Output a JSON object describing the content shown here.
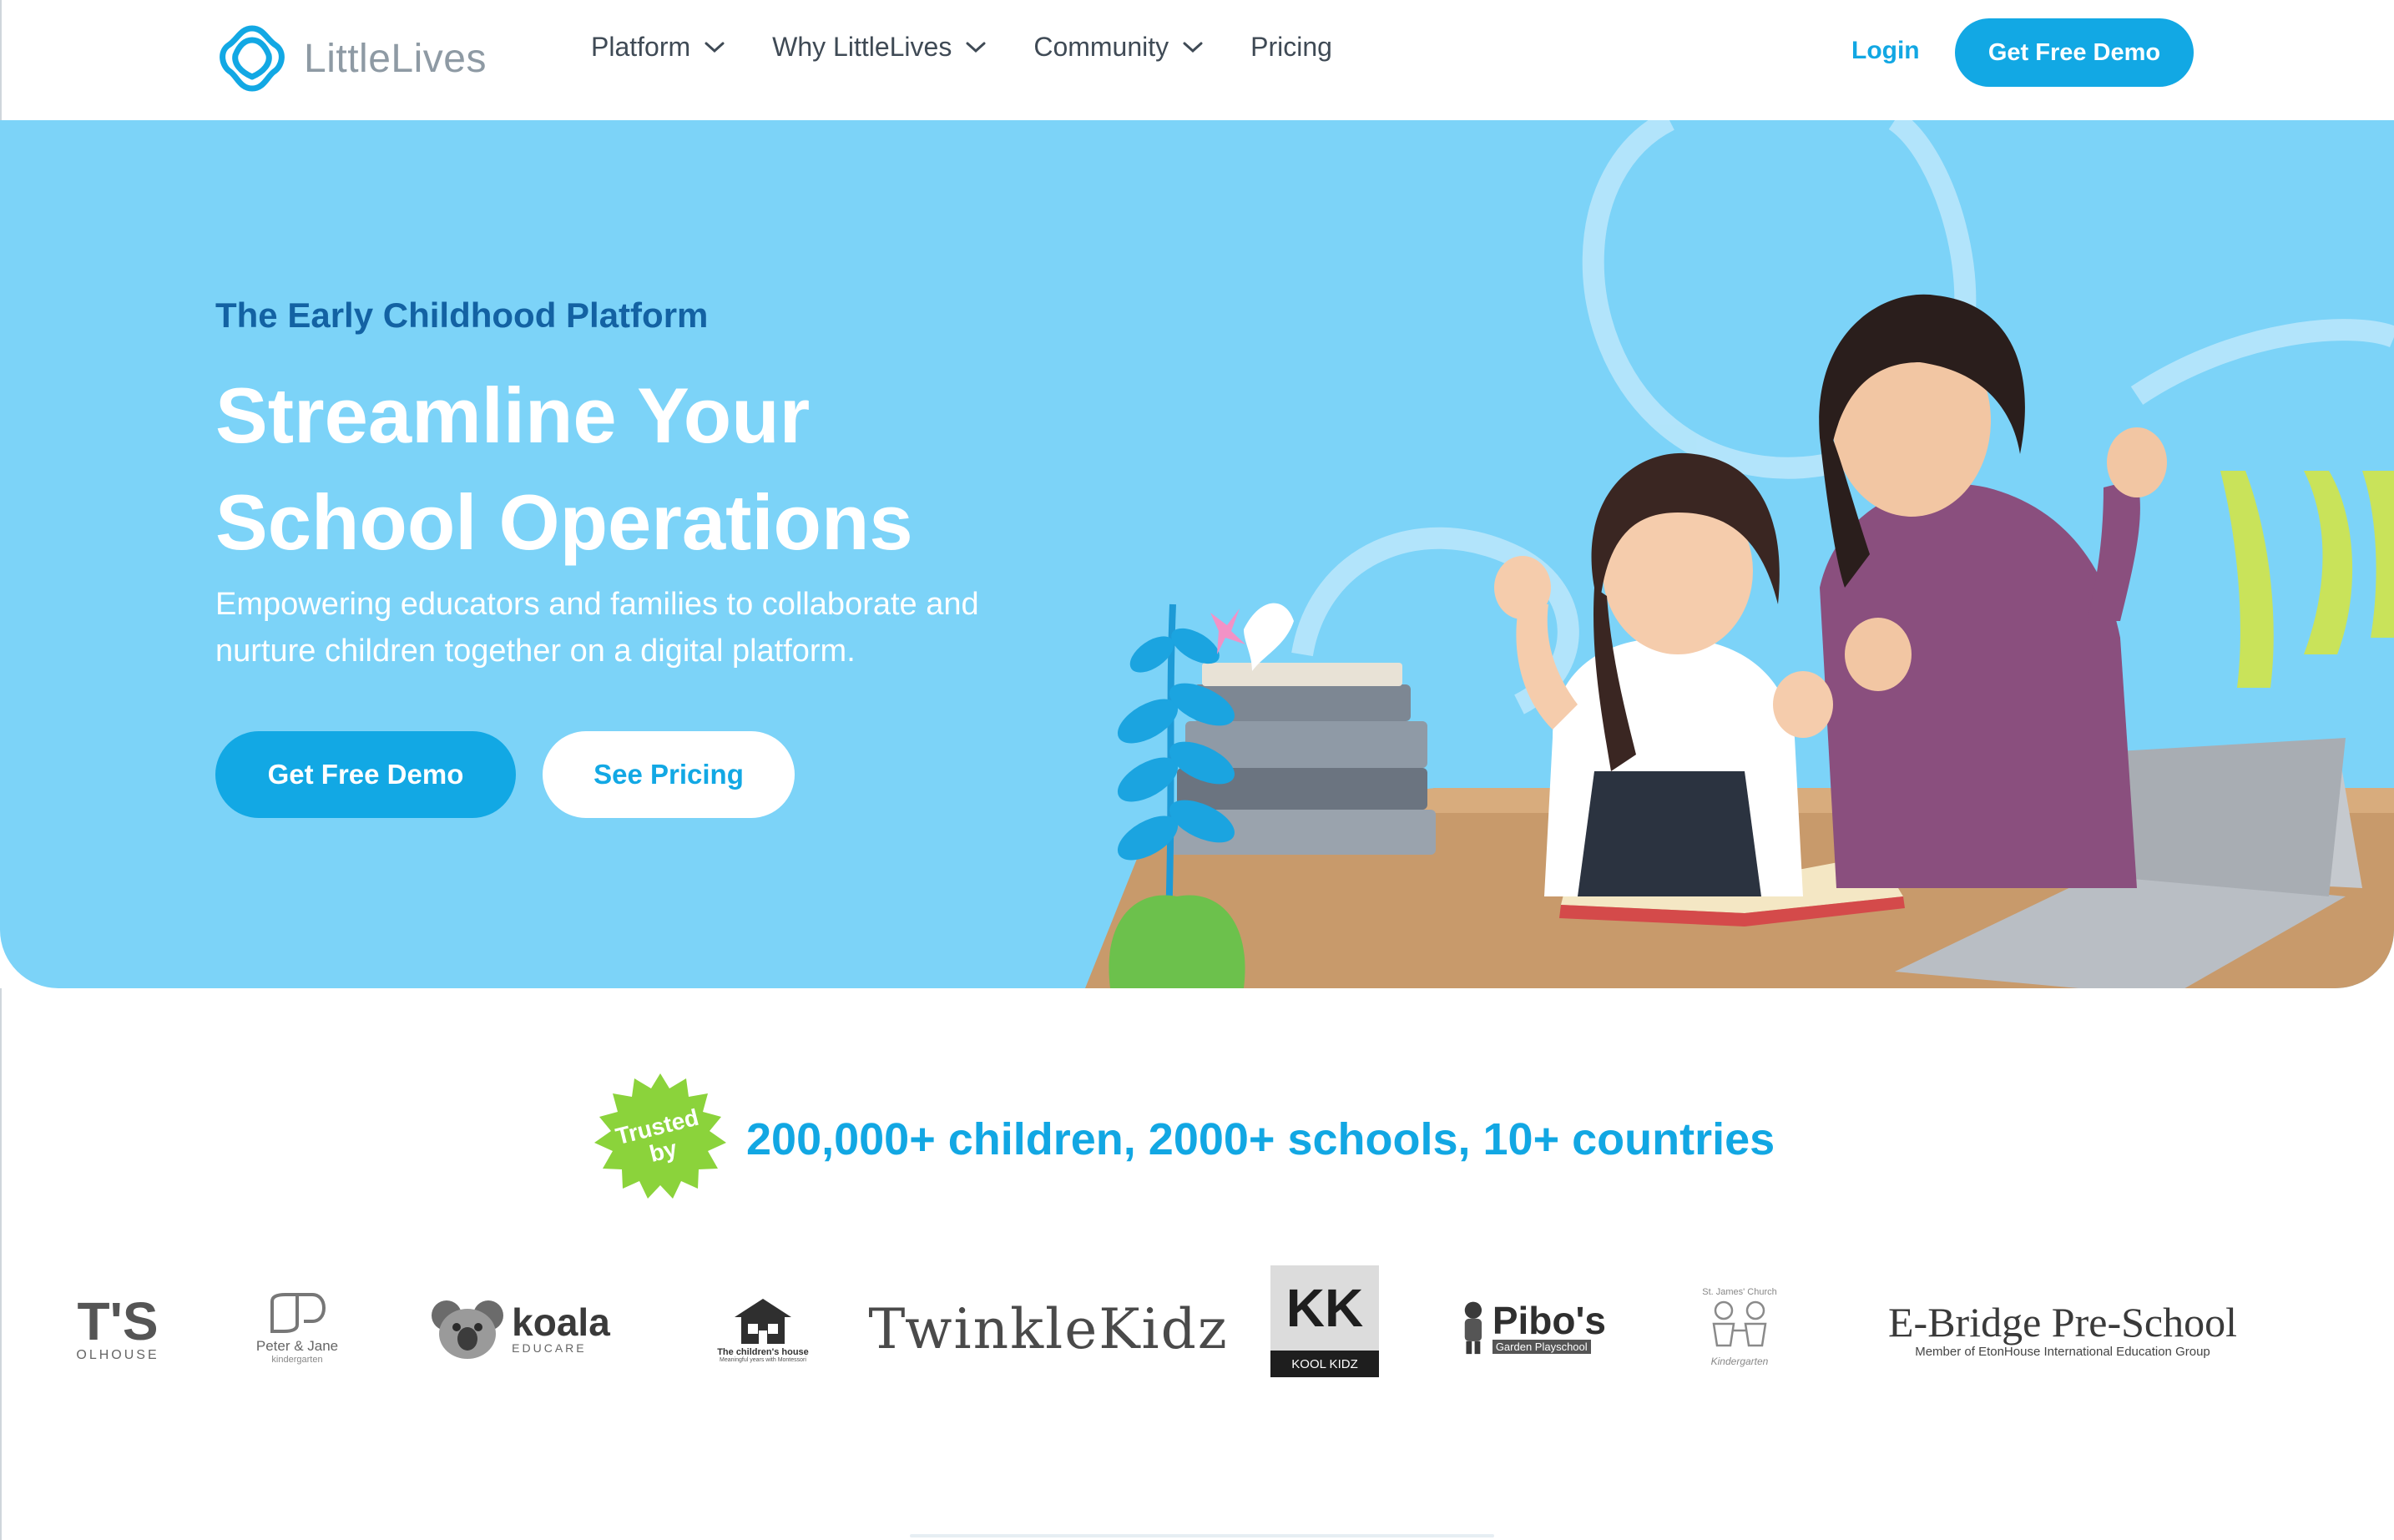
{
  "brand": {
    "name": "LittleLives",
    "accent": "#12a8e4",
    "hero_bg": "#7cd3f8",
    "eyebrow_color": "#1362a3",
    "badge_green": "#8bd33b"
  },
  "nav": {
    "items": [
      {
        "label": "Platform",
        "has_dropdown": true
      },
      {
        "label": "Why LittleLives",
        "has_dropdown": true
      },
      {
        "label": "Community",
        "has_dropdown": true
      },
      {
        "label": "Pricing",
        "has_dropdown": false
      }
    ],
    "login_label": "Login",
    "demo_label": "Get Free Demo"
  },
  "hero": {
    "eyebrow": "The Early Childhood Platform",
    "headline_line1": "Streamline Your",
    "headline_line2": "School Operations",
    "subtext": "Empowering educators and families to collaborate and nurture children together on a digital platform.",
    "primary_cta": "Get Free Demo",
    "secondary_cta": "See Pricing"
  },
  "trusted": {
    "badge_line1": "Trusted",
    "badge_line2": "by",
    "stats": "200,000+ children, 2000+ schools, 10+ countries"
  },
  "partner_logos": {
    "schoolhouse_big": "T'S",
    "schoolhouse_small": "OLHOUSE",
    "peter_jane_name": "Peter & Jane",
    "peter_jane_sub": "kindergarten",
    "koala_name": "koala",
    "koala_sub": "EDUCARE",
    "childrens_house_name": "The children's house",
    "childrens_house_sub": "Meaningful years with Montessori",
    "twinkle": "TwinkleKidz",
    "kool_mark": "KK",
    "kool_name": "KOOL KIDZ",
    "pibo_name": "Pibo's",
    "pibo_sub": "Garden Playschool",
    "stjames_top": "St. James' Church",
    "stjames_bottom": "Kindergarten",
    "ebridge_name": "E-Bridge Pre-School",
    "ebridge_sub": "Member of EtonHouse International Education Group"
  }
}
